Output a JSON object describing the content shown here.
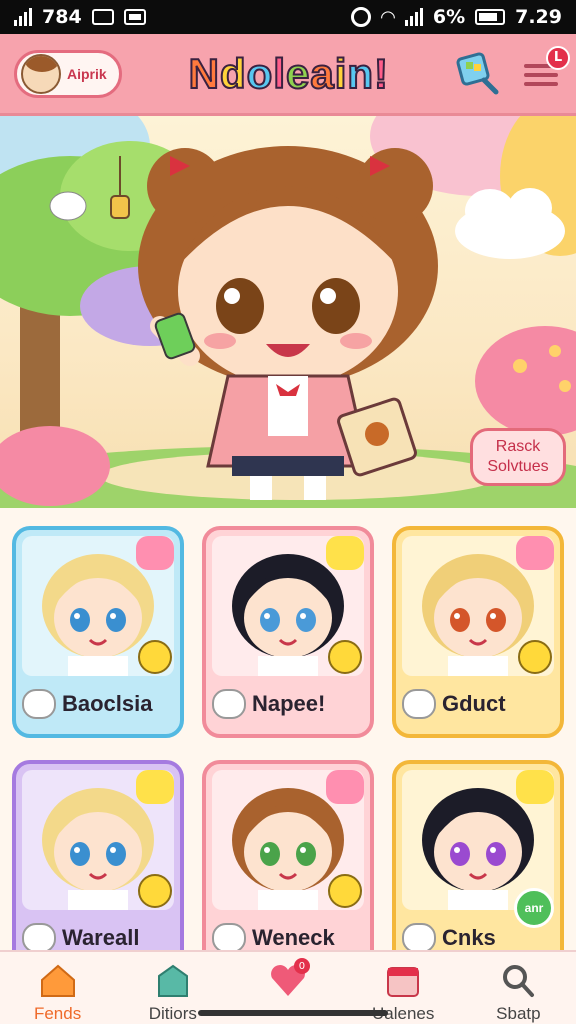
{
  "status_bar": {
    "left_text": "784",
    "battery_text": "6%",
    "time": "7.29"
  },
  "header": {
    "profile_label": "Aiprik",
    "logo_text": "Ndoleain!",
    "notification_count": "L"
  },
  "hero": {
    "button_line1": "Rasck",
    "button_line2": "Solvtues"
  },
  "cards": [
    {
      "name": "Baoclsia",
      "theme": "blue"
    },
    {
      "name": "Napee!",
      "theme": "pink"
    },
    {
      "name": "Gduct",
      "theme": "yellow"
    },
    {
      "name": "Wareall",
      "theme": "purple"
    },
    {
      "name": "Weneck",
      "theme": "pink"
    },
    {
      "name": "Cnks",
      "theme": "yellow",
      "badge": "anr"
    }
  ],
  "bottom_nav": [
    {
      "label": "Fends",
      "icon": "home-icon",
      "active": true
    },
    {
      "label": "Ditiors",
      "icon": "shop-icon",
      "active": false
    },
    {
      "label": "",
      "icon": "heart-icon",
      "active": false,
      "dot": "0"
    },
    {
      "label": "Ualenes",
      "icon": "calendar-icon",
      "active": false
    },
    {
      "label": "Sbatp",
      "icon": "search-icon",
      "active": false
    }
  ],
  "colors": {
    "header_bg": "#f7a3ad",
    "active_nav": "#ef6a2a",
    "badge_red": "#e3304b"
  }
}
